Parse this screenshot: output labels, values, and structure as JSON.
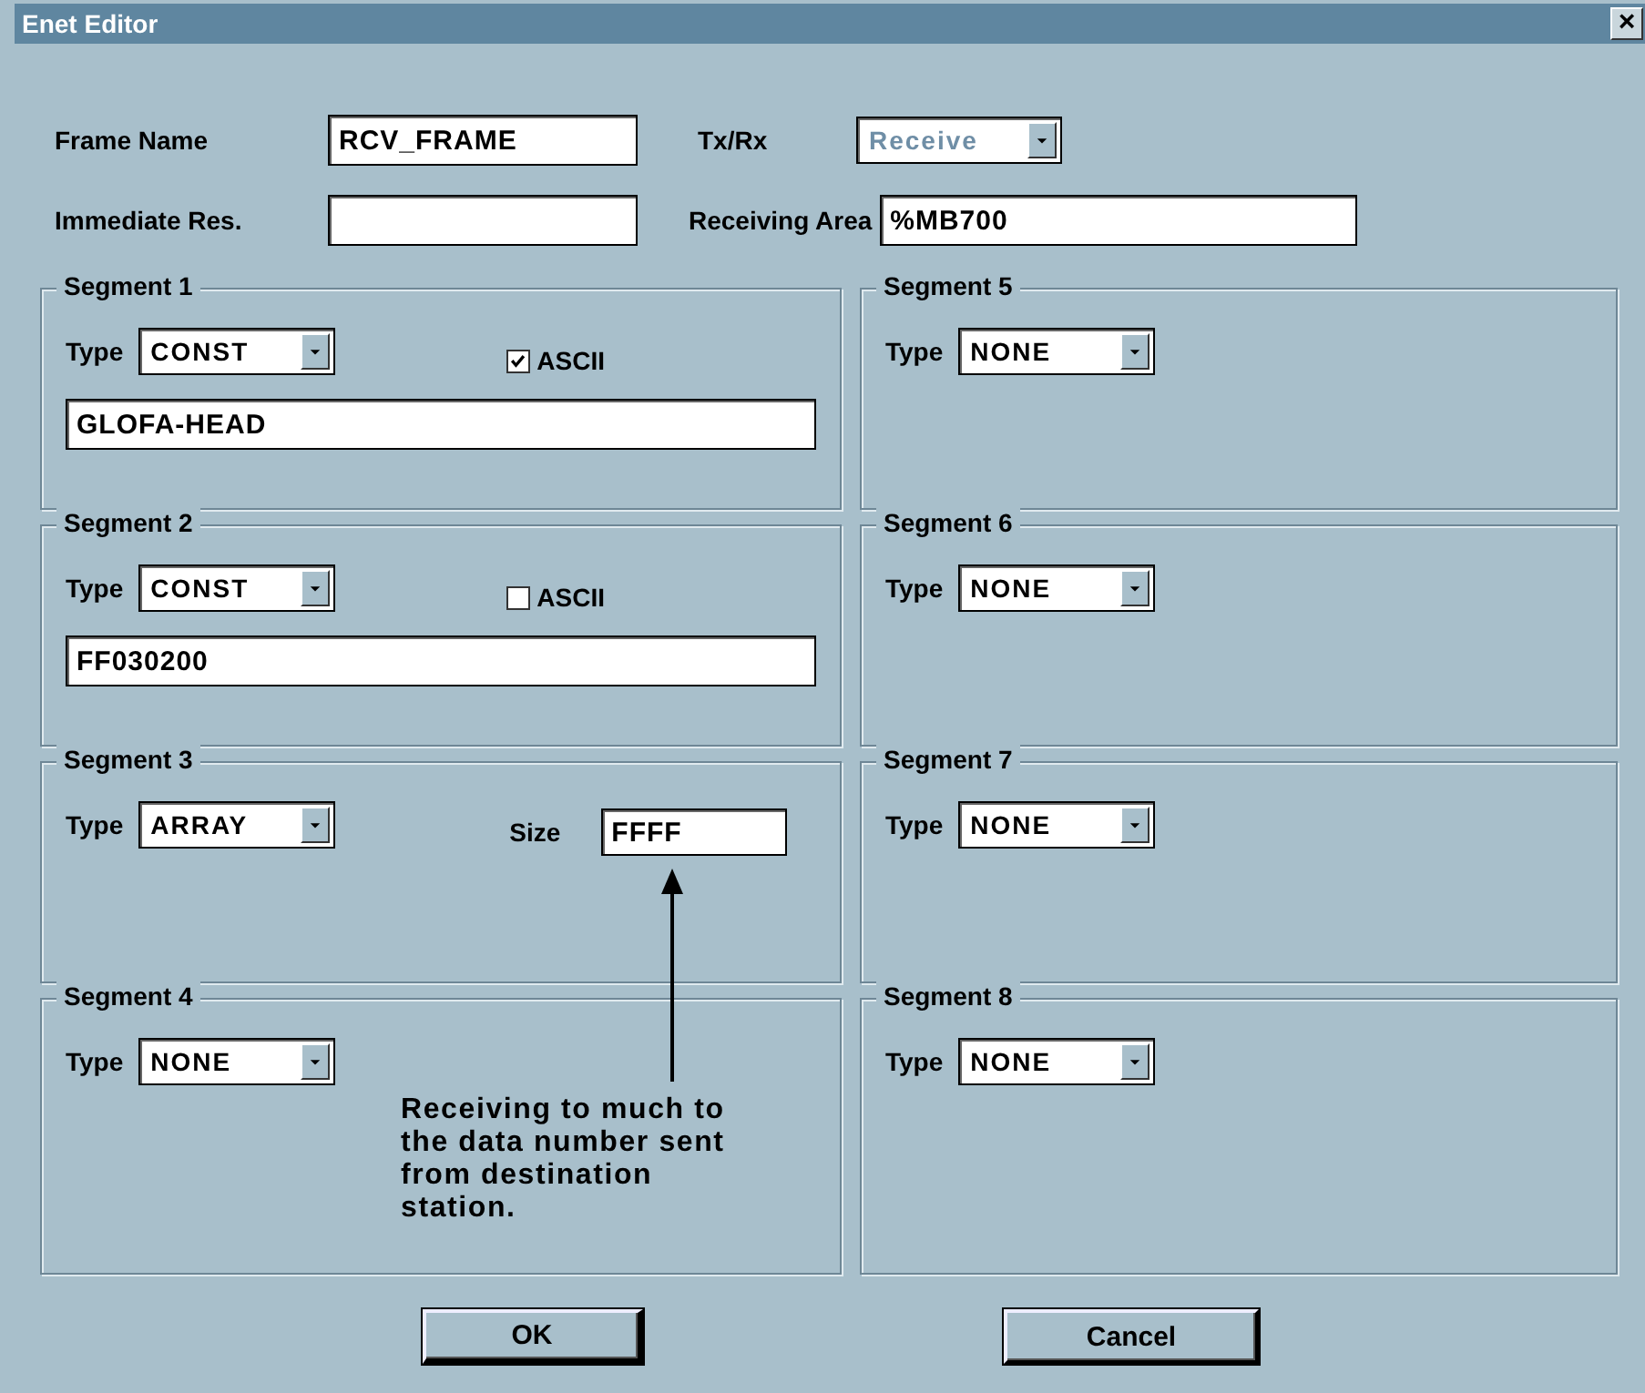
{
  "window": {
    "title": "Enet Editor",
    "close": "×"
  },
  "header": {
    "frame_name_label": "Frame Name",
    "frame_name": "RCV_FRAME",
    "txrx_label": "Tx/Rx",
    "txrx": "Receive",
    "txrx_disabled": true,
    "immediate_label": "Immediate Res.",
    "area_label": "Receiving Area",
    "area": "%MB700"
  },
  "segments": [
    {
      "title": "Segment 1",
      "type_label": "Type",
      "type": "CONST",
      "kind": "const",
      "ascii_label": "ASCII",
      "ascii_checked": true,
      "data": "GLOFA-HEAD"
    },
    {
      "title": "Segment 2",
      "type_label": "Type",
      "type": "CONST",
      "kind": "const",
      "ascii_label": "ASCII",
      "ascii_checked": false,
      "data": "FF030200"
    },
    {
      "title": "Segment 3",
      "type_label": "Type",
      "type": "ARRAY",
      "kind": "array",
      "size_label": "Size",
      "size": "FFFF"
    },
    {
      "title": "Segment 4",
      "type_label": "Type",
      "type": "NONE",
      "kind": "none"
    },
    {
      "title": "Segment 5",
      "type_label": "Type",
      "type": "NONE",
      "kind": "none"
    },
    {
      "title": "Segment 6",
      "type_label": "Type",
      "type": "NONE",
      "kind": "none"
    },
    {
      "title": "Segment 7",
      "type_label": "Type",
      "type": "NONE",
      "kind": "none"
    },
    {
      "title": "Segment 8",
      "type_label": "Type",
      "type": "NONE",
      "kind": "none"
    }
  ],
  "note": {
    "text": "Receiving to much to the data number sent from destination station."
  },
  "buttons": [
    {
      "label": "OK",
      "default": true
    },
    {
      "label": "Cancel",
      "default": false
    }
  ]
}
